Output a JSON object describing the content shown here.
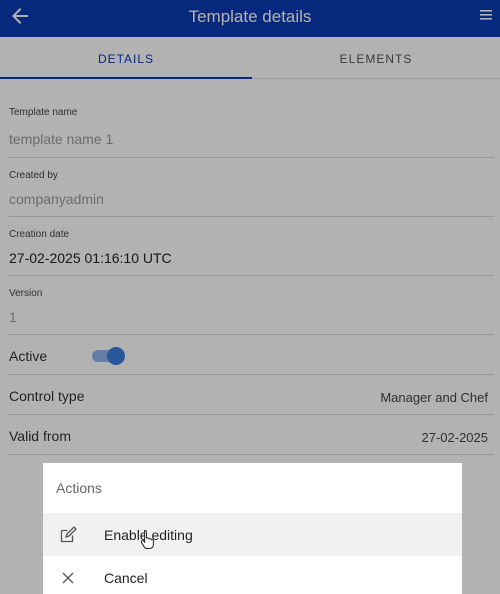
{
  "header": {
    "title": "Template details",
    "back_icon": "arrow-left-icon",
    "menu_icon": "hamburger-menu-icon"
  },
  "tabs": [
    {
      "label": "DETAILS",
      "active": true
    },
    {
      "label": "ELEMENTS",
      "active": false
    }
  ],
  "fields": {
    "template_name": {
      "label": "Template name",
      "value": "template name 1"
    },
    "created_by": {
      "label": "Created by",
      "value": "companyadmin"
    },
    "creation_date": {
      "label": "Creation date",
      "value": "27-02-2025 01:16:10 UTC"
    },
    "version": {
      "label": "Version",
      "value": "1"
    },
    "active": {
      "label": "Active",
      "on": true
    },
    "control_type": {
      "label": "Control type",
      "value": "Manager and Chef"
    },
    "valid_from": {
      "label": "Valid from",
      "value": "27-02-2025"
    }
  },
  "actions_sheet": {
    "title": "Actions",
    "items": [
      {
        "label": "Enable editing",
        "icon": "edit-icon"
      },
      {
        "label": "Cancel",
        "icon": "close-icon"
      }
    ]
  },
  "colors": {
    "primary": "#0a3cb4",
    "toggle": "#3d7be0"
  }
}
